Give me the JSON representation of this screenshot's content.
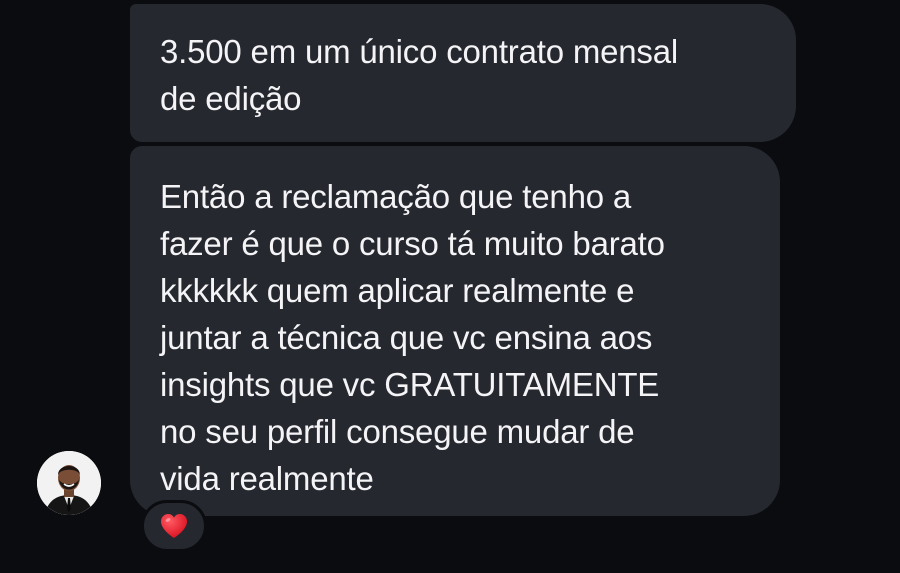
{
  "messages": [
    {
      "lines": [
        "3.500 em um único contrato mensal",
        "de edição"
      ]
    },
    {
      "lines": [
        "Então a reclamação que tenho a",
        "fazer é que o curso tá muito barato",
        "kkkkkk quem aplicar realmente e",
        "juntar a técnica que vc ensina aos",
        "insights que vc GRATUITAMENTE",
        "no seu perfil consegue mudar de",
        "vida realmente"
      ]
    }
  ],
  "reaction": {
    "icon": "heart-icon",
    "color": "#e8192c"
  },
  "colors": {
    "background": "#0b0c10",
    "bubble": "#262830",
    "text": "#f4f4f6"
  }
}
